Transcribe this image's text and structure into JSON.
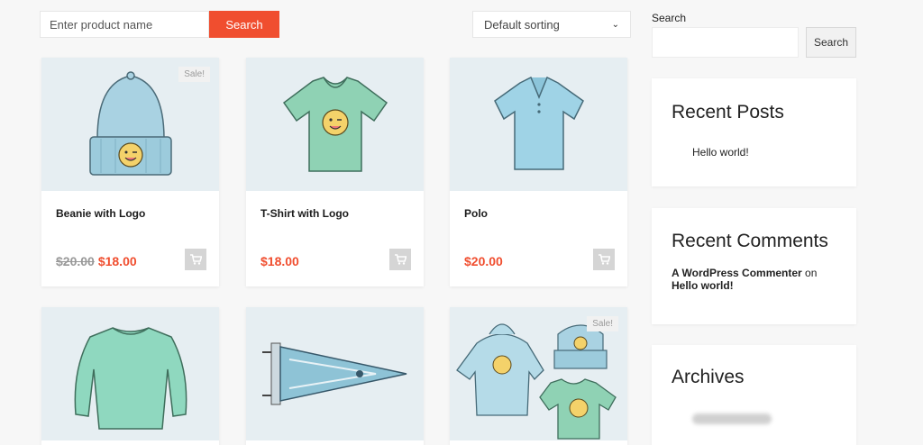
{
  "toolbar": {
    "product_placeholder": "Enter product name",
    "search_label": "Search",
    "sort_label": "Default sorting"
  },
  "products": [
    {
      "title": "Beanie with Logo",
      "old_price": "$20.00",
      "price": "$18.00",
      "sale": "Sale!",
      "icon": "beanie-image"
    },
    {
      "title": "T-Shirt with Logo",
      "price": "$18.00",
      "icon": "tshirt-image"
    },
    {
      "title": "Polo",
      "price": "$20.00",
      "icon": "polo-image"
    },
    {
      "icon": "long-sleeve-image"
    },
    {
      "icon": "pennant-image"
    },
    {
      "sale": "Sale!",
      "icon": "hoodie-set-image"
    }
  ],
  "sidebar": {
    "search_label": "Search",
    "search_button": "Search",
    "recent_posts": {
      "title": "Recent Posts",
      "items": [
        "Hello world!"
      ]
    },
    "recent_comments": {
      "title": "Recent Comments",
      "author": "A WordPress Commenter",
      "on": "on",
      "post": "Hello world!"
    },
    "archives": {
      "title": "Archives"
    }
  },
  "colors": {
    "accent": "#f04e2f",
    "product_bg": "#e6eef2",
    "page_bg": "#f7f7f7"
  }
}
